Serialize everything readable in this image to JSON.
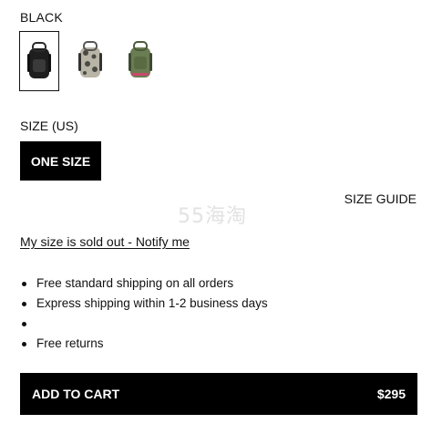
{
  "product": {
    "color_label": "BLACK",
    "swatches": [
      {
        "name": "black-backpack",
        "selected": true,
        "colors": {
          "main": "#1e1e1e",
          "accent": "#3a3a3a"
        }
      },
      {
        "name": "camo-backpack",
        "selected": false,
        "colors": {
          "main": "#b8b4a6",
          "accent": "#4a4a44"
        }
      },
      {
        "name": "green-backpack",
        "selected": false,
        "colors": {
          "main": "#6a7d52",
          "accent": "#c84a6a"
        }
      }
    ],
    "size_label": "SIZE (US)",
    "size_option": "ONE SIZE",
    "size_guide": "SIZE GUIDE",
    "notify_link": "My size is sold out - Notify me",
    "shipping_items": [
      "Free standard shipping on all orders",
      "Express shipping within 1-2 business days",
      "",
      "Free returns"
    ],
    "cart": {
      "label": "ADD TO CART",
      "price": "$295"
    }
  },
  "watermark": "55海淘"
}
